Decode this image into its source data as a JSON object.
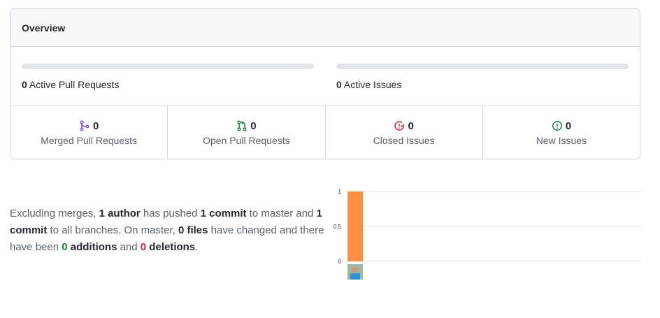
{
  "overview": {
    "title": "Overview",
    "active_pull_requests": {
      "count": "0",
      "label": "Active Pull Requests",
      "progress": 0
    },
    "active_issues": {
      "count": "0",
      "label": "Active Issues",
      "progress": 0
    },
    "stats": {
      "merged_pull_requests": {
        "count": "0",
        "label": "Merged Pull Requests",
        "color": "#8250df",
        "icon": "git-merge-icon"
      },
      "open_pull_requests": {
        "count": "0",
        "label": "Open Pull Requests",
        "color": "#1a7f37",
        "icon": "git-pull-request-icon"
      },
      "closed_issues": {
        "count": "0",
        "label": "Closed Issues",
        "color": "#cf222e",
        "icon": "issue-closed-icon"
      },
      "new_issues": {
        "count": "0",
        "label": "New Issues",
        "color": "#1a7f37",
        "icon": "issue-opened-icon"
      }
    }
  },
  "summary": {
    "t1": "Excluding merges, ",
    "authors": "1 author",
    "t2": " has pushed ",
    "commits_master": "1 commit",
    "t3": " to master and ",
    "commits_all": "1 commit",
    "t4": " to all branches. On master, ",
    "files": "0 files",
    "t5": " have changed and there have been ",
    "additions_count": "0",
    "additions_word": " additions",
    "t6": " and ",
    "deletions_count": "0",
    "deletions_word": " deletions",
    "t7": "."
  },
  "chart_data": {
    "type": "bar",
    "categories": [
      "author-avatar"
    ],
    "values": [
      1
    ],
    "ylim": [
      0,
      1
    ],
    "yticks": [
      "0",
      "0.5",
      "1"
    ],
    "bar_color": "#fb8f44",
    "grid": true
  }
}
